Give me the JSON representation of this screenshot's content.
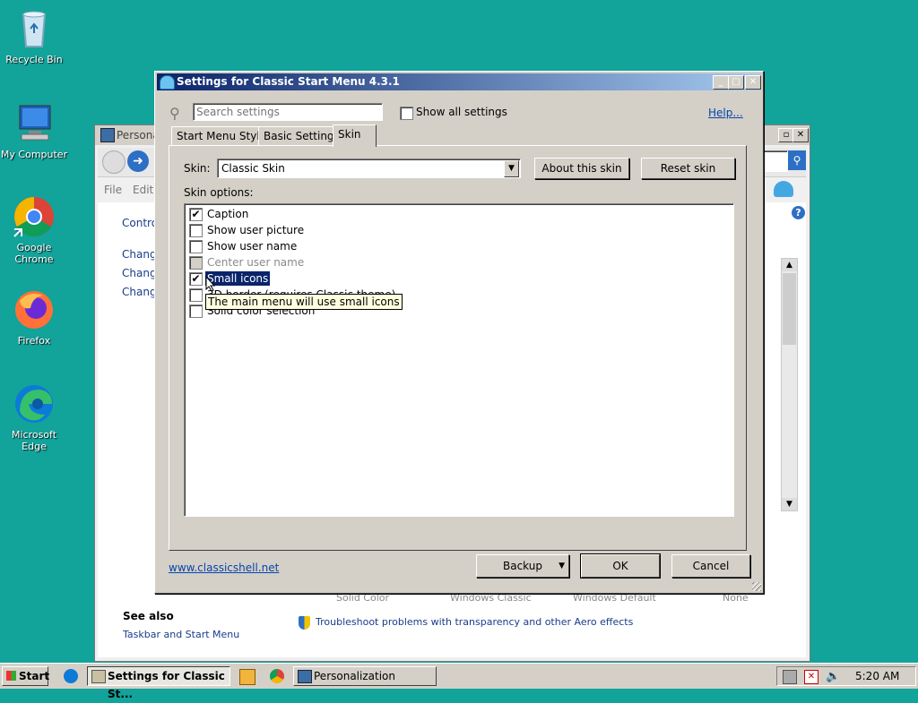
{
  "desktop": {
    "icons": [
      {
        "label": "Recycle Bin",
        "icon": "recycle-bin-icon"
      },
      {
        "label": "My Computer",
        "icon": "computer-icon"
      },
      {
        "label": "Google Chrome",
        "icon": "chrome-icon"
      },
      {
        "label": "Firefox",
        "icon": "firefox-icon"
      },
      {
        "label": "Microsoft Edge",
        "icon": "edge-icon"
      }
    ]
  },
  "background_window": {
    "title": "Persona",
    "menu": [
      "File",
      "Edit"
    ],
    "sidebar_links": [
      "Control",
      "Change",
      "Change",
      "Change"
    ],
    "swatch_labels": [
      "Solid Color",
      "Windows Classic",
      "Windows Default",
      "None"
    ],
    "see_also_heading": "See also",
    "see_also_link": "Taskbar and Start Menu",
    "troubleshoot_link": "Troubleshoot problems with transparency and other Aero effects"
  },
  "dialog": {
    "title": "Settings for Classic Start Menu 4.3.1",
    "search_placeholder": "Search settings",
    "show_all_label": "Show all settings",
    "help_link": "Help...",
    "tabs": [
      "Start Menu Style",
      "Basic Settings",
      "Skin"
    ],
    "active_tab": "Skin",
    "skin_label": "Skin:",
    "skin_value": "Classic Skin",
    "about_button": "About this skin",
    "reset_button": "Reset skin",
    "skin_options_label": "Skin options:",
    "options": [
      {
        "label": "Caption",
        "checked": true,
        "disabled": false
      },
      {
        "label": "Show user picture",
        "checked": false,
        "disabled": false
      },
      {
        "label": "Show user name",
        "checked": false,
        "disabled": false
      },
      {
        "label": "Center user name",
        "checked": false,
        "disabled": true
      },
      {
        "label": "Small icons",
        "checked": true,
        "disabled": false,
        "selected": true
      },
      {
        "label": "3D border (requires Classic theme)",
        "checked": false,
        "disabled": false
      },
      {
        "label": "Solid color selection",
        "checked": false,
        "disabled": false
      }
    ],
    "tooltip": "The main menu will use small icons",
    "website_link": "www.classicshell.net",
    "backup_button": "Backup",
    "ok_button": "OK",
    "cancel_button": "Cancel"
  },
  "taskbar": {
    "start_label": "Start",
    "tasks": [
      {
        "label": "Settings for Classic St...",
        "active": true
      },
      {
        "label": "Personalization",
        "active": false
      }
    ],
    "clock": "5:20 AM"
  },
  "colors": {
    "desktop": "#12a39a",
    "title_active_start": "#0a246a",
    "title_active_end": "#a6caf0",
    "selection": "#0a246a",
    "tooltip_bg": "#ffffe1"
  }
}
